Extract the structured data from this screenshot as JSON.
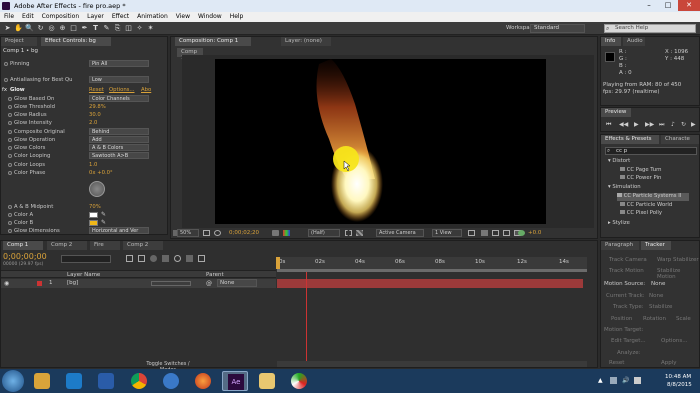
{
  "window": {
    "title": "Adobe After Effects - fire pro.aep *",
    "minimize": "–",
    "maximize": "□",
    "close": "✕"
  },
  "menu": [
    "File",
    "Edit",
    "Composition",
    "Layer",
    "Effect",
    "Animation",
    "View",
    "Window",
    "Help"
  ],
  "toolbar": {
    "workspace_label": "Workspace:",
    "workspace_value": "Standard",
    "search_placeholder": "Search Help"
  },
  "left_panel": {
    "tabs": [
      "Project",
      "Effect Controls: bg"
    ],
    "breadcrumb": "Comp 1 • bg",
    "rows": [
      {
        "label": "Pinning",
        "dropdown": "Pin All"
      },
      {
        "label": "Antialiasing for Best Qu",
        "dropdown": "Low"
      },
      {
        "label": "Glow",
        "reset": "Reset",
        "options": "Options...",
        "about": "Abo"
      },
      {
        "label": "Glow Based On",
        "dropdown": "Color Channels"
      },
      {
        "label": "Glow Threshold",
        "value": "29.8%"
      },
      {
        "label": "Glow Radius",
        "value": "30.0"
      },
      {
        "label": "Glow Intensity",
        "value": "2.0"
      },
      {
        "label": "Composite Original",
        "dropdown": "Behind"
      },
      {
        "label": "Glow Operation",
        "dropdown": "Add"
      },
      {
        "label": "Glow Colors",
        "dropdown": "A & B Colors"
      },
      {
        "label": "Color Looping",
        "dropdown": "Sawtooth A>B"
      },
      {
        "label": "Color Loops",
        "value": "1.0"
      },
      {
        "label": "Color Phase",
        "value": "0x +0.0°"
      },
      {
        "label": "A & B Midpoint",
        "value": "70%"
      },
      {
        "label": "Color A",
        "value": ""
      },
      {
        "label": "Color B",
        "value": ""
      },
      {
        "label": "Glow Dimensions",
        "dropdown": "Horizontal and Ver"
      }
    ]
  },
  "composition": {
    "tab_label": "Composition: Comp 1",
    "layer_tab": "Layer: (none)",
    "sub_tab": "Comp 1",
    "zoom": "50%",
    "timecode": "0;00;02;20",
    "resolution": "(Half)",
    "camera": "Active Camera",
    "view": "1 View",
    "exposure": "+0.0"
  },
  "info": {
    "tabs": [
      "Info",
      "Audio"
    ],
    "r": "R :",
    "g": "G :",
    "b": "B :",
    "a": "A : 0",
    "x": "X : 1096",
    "y": "Y : 448",
    "playing": "Playing from RAM: 80 of 450",
    "fps": "fps: 29.97 (realtime)"
  },
  "preview": {
    "tab": "Preview"
  },
  "effects": {
    "tabs": [
      "Effects & Presets",
      "Characte"
    ],
    "search": "cc p",
    "items": [
      {
        "label": "Distort",
        "type": "category"
      },
      {
        "label": "CC Page Turn",
        "type": "effect"
      },
      {
        "label": "CC Power Pin",
        "type": "effect"
      },
      {
        "label": "Simulation",
        "type": "category"
      },
      {
        "label": "CC Particle Systems II",
        "type": "effect",
        "selected": true
      },
      {
        "label": "CC Particle World",
        "type": "effect"
      },
      {
        "label": "CC Pixel Polly",
        "type": "effect"
      },
      {
        "label": "Stylize",
        "type": "category"
      }
    ]
  },
  "timeline": {
    "tabs": [
      "Comp 1",
      "Comp 2",
      "Fire",
      "Comp 2"
    ],
    "timecode": "0;00;00;00",
    "fps": "00000 (29.97 fps)",
    "col_layer": "Layer Name",
    "col_parent": "Parent",
    "layer_num": "1",
    "layer_name": "[bg]",
    "parent_value": "None",
    "toggle": "Toggle Switches / Modes",
    "ruler": [
      "0s",
      "02s",
      "04s",
      "06s",
      "08s",
      "10s",
      "12s",
      "14s"
    ]
  },
  "right_bottom": {
    "tabs": [
      "Paragraph",
      "Tracker"
    ],
    "items": [
      "Track Camera",
      "Warp Stabilizer",
      "Track Motion",
      "Stabilize Motion",
      "Motion Source:",
      "None",
      "Current Track:",
      "None",
      "Track Type:",
      "Stabilize",
      "Position",
      "Rotation",
      "Scale",
      "Motion Target:",
      "Edit Target...",
      "Options...",
      "Analyze:",
      "Reset",
      "Apply"
    ]
  },
  "taskbar": {
    "time": "10:48 AM",
    "date": "8/8/2015"
  }
}
